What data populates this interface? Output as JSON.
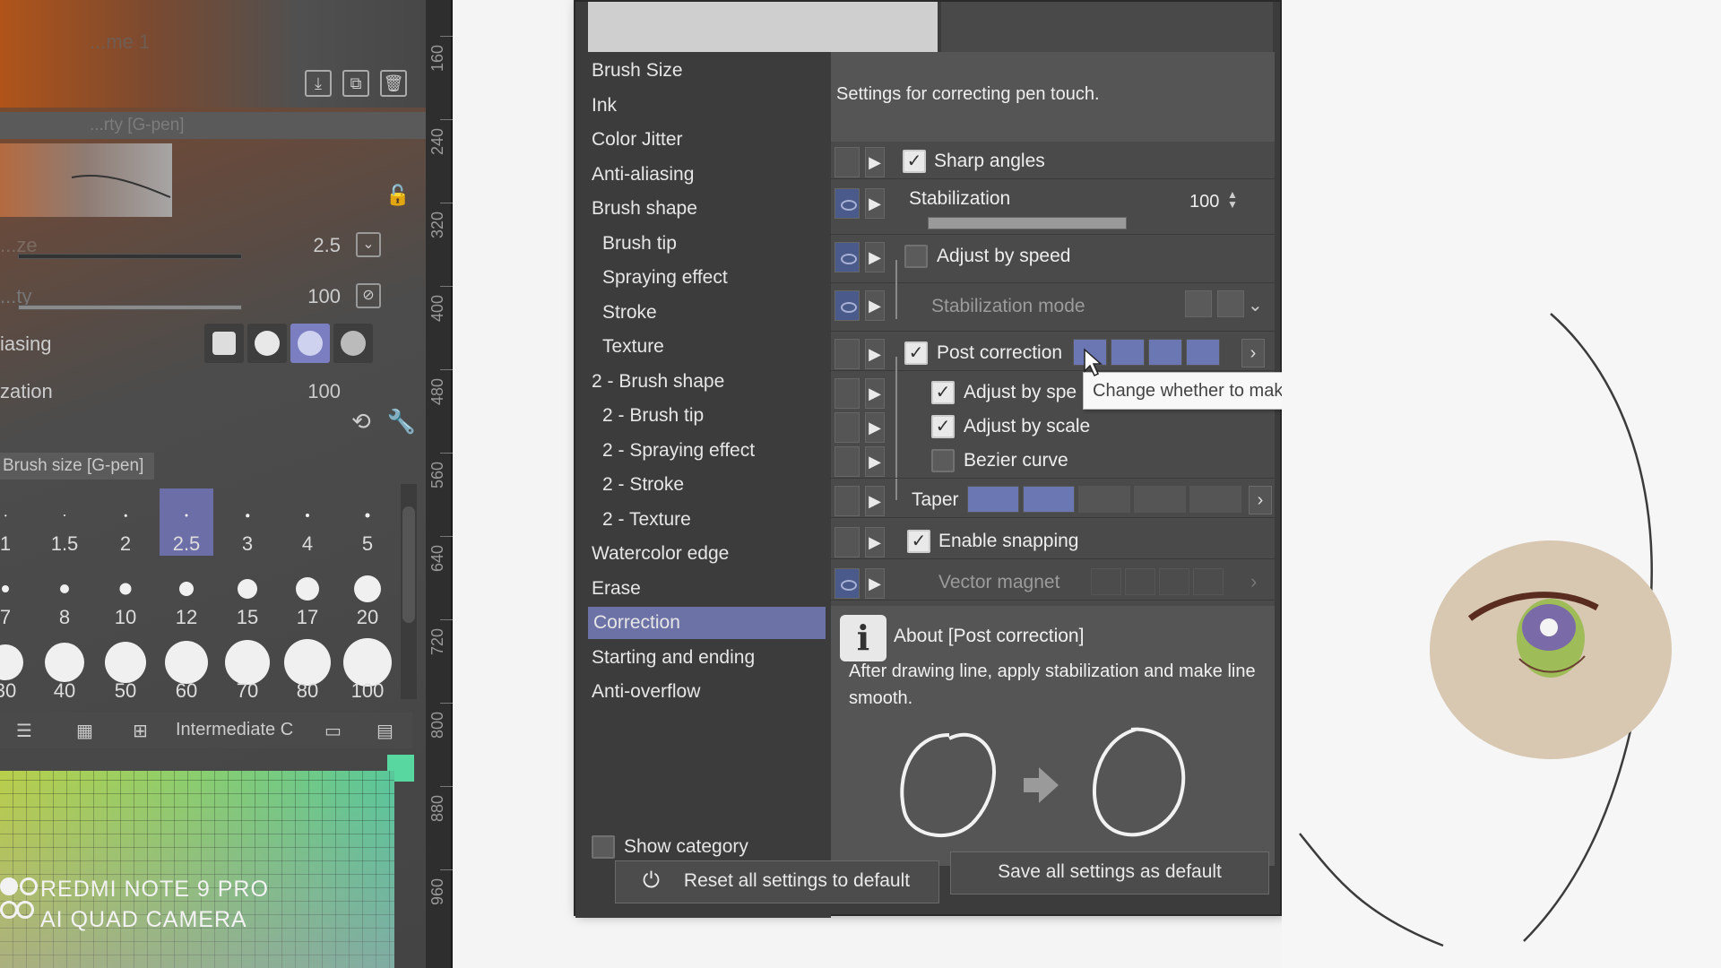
{
  "left_panel": {
    "faded_title": "...me 1",
    "subtool_header": "...rty [G-pen]",
    "brush_size_row": {
      "label": "...ze",
      "value": "2.5"
    },
    "opacity_row": {
      "label": "...ty",
      "value": "100"
    },
    "antialiasing_row": {
      "label": "iasing"
    },
    "stabilization_row": {
      "label": "zation",
      "value": "100"
    },
    "brush_size_panel_title": "Brush size [G-pen]",
    "brush_sizes": [
      "1",
      "1.5",
      "2",
      "2.5",
      "3",
      "4",
      "5",
      "7",
      "8",
      "10",
      "12",
      "15",
      "17",
      "20",
      "30",
      "40",
      "50",
      "60",
      "70",
      "80",
      "100"
    ],
    "selected_brush_size": "2.5",
    "bottom_tab_label": "Intermediate C",
    "ruler_marks": [
      "160",
      "240",
      "320",
      "400",
      "480",
      "560",
      "640",
      "720",
      "800",
      "880",
      "960"
    ],
    "accent_color": "#6c72a6"
  },
  "watermark": {
    "line1": "REDMI NOTE 9 PRO",
    "line2": "AI QUAD CAMERA"
  },
  "dialog": {
    "categories": [
      {
        "label": "Brush Size",
        "sub": false
      },
      {
        "label": "Ink",
        "sub": false
      },
      {
        "label": "Color Jitter",
        "sub": false
      },
      {
        "label": "Anti-aliasing",
        "sub": false
      },
      {
        "label": "Brush shape",
        "sub": false
      },
      {
        "label": "Brush tip",
        "sub": true
      },
      {
        "label": "Spraying effect",
        "sub": true
      },
      {
        "label": "Stroke",
        "sub": true
      },
      {
        "label": "Texture",
        "sub": true
      },
      {
        "label": "2 - Brush shape",
        "sub": false
      },
      {
        "label": "2 - Brush tip",
        "sub": true
      },
      {
        "label": "2 - Spraying effect",
        "sub": true
      },
      {
        "label": "2 - Stroke",
        "sub": true
      },
      {
        "label": "2 - Texture",
        "sub": true
      },
      {
        "label": "Watercolor edge",
        "sub": false
      },
      {
        "label": "Erase",
        "sub": false
      },
      {
        "label": "Correction",
        "sub": false,
        "selected": true
      },
      {
        "label": "Starting and ending",
        "sub": false
      },
      {
        "label": "Anti-overflow",
        "sub": false
      }
    ],
    "show_category_label": "Show category",
    "show_category_checked": false,
    "description": "Settings for correcting pen touch.",
    "settings": {
      "sharp_angles": {
        "label": "Sharp angles",
        "checked": true
      },
      "stabilization": {
        "label": "Stabilization",
        "value": "100",
        "level_percent": 100
      },
      "adjust_by_speed": {
        "label": "Adjust by speed",
        "checked": false
      },
      "stabilization_mode": {
        "label": "Stabilization mode"
      },
      "post_correction": {
        "label": "Post correction",
        "checked": true
      },
      "post_adjust_by_speed": {
        "label": "Adjust by spe",
        "checked": true
      },
      "adjust_by_scale": {
        "label": "Adjust by scale",
        "checked": true
      },
      "bezier_curve": {
        "label": "Bezier curve",
        "checked": false
      },
      "taper": {
        "label": "Taper"
      },
      "enable_snapping": {
        "label": "Enable snapping",
        "checked": true
      },
      "vector_magnet": {
        "label": "Vector magnet"
      }
    },
    "about": {
      "title": "About [Post correction]",
      "text": "After drawing line, apply stabilization and make line smooth."
    },
    "reset_button": "Reset all settings to default",
    "save_button": "Save all settings as default"
  },
  "tooltip": "Change whether to make line smoother and degree of correction"
}
